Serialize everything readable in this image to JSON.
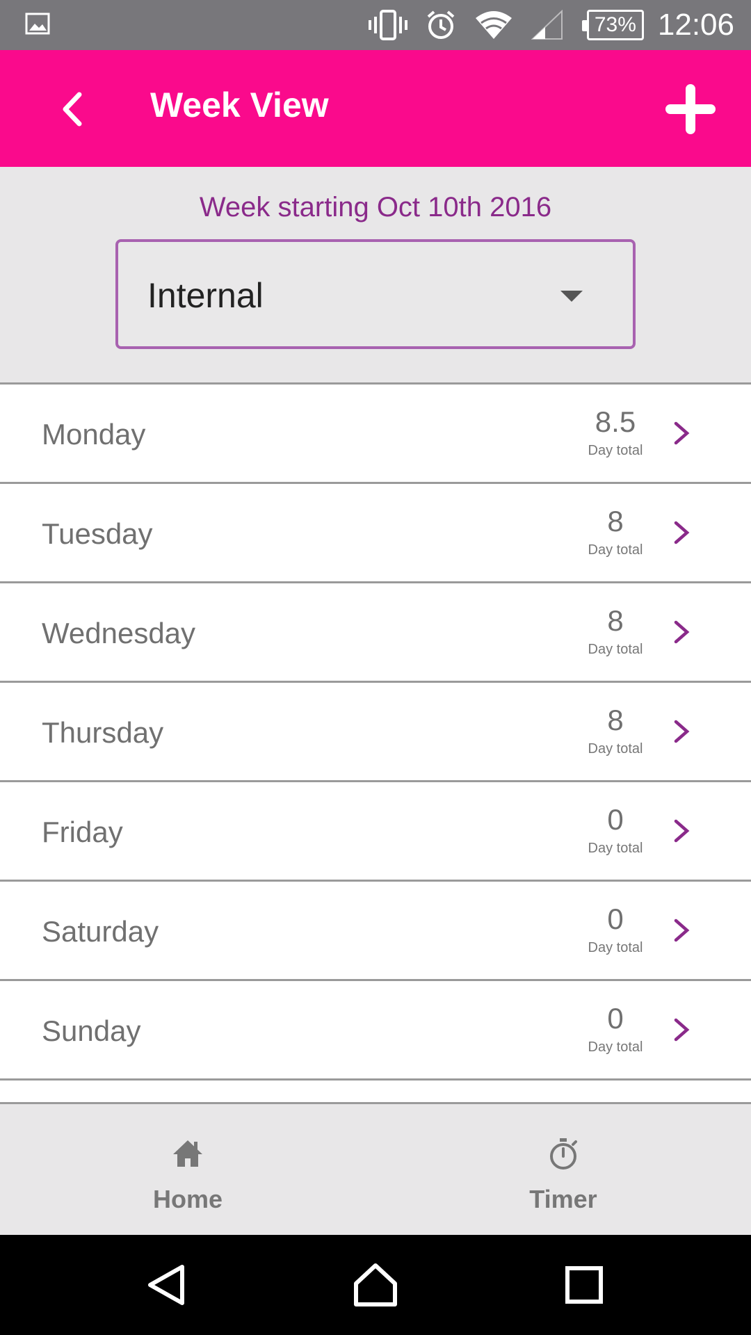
{
  "status_bar": {
    "battery": "73%",
    "time": "12:06",
    "icons": [
      "image-icon",
      "vibrate-icon",
      "alarm-icon",
      "wifi-icon",
      "signal-icon",
      "battery-icon"
    ]
  },
  "app_bar": {
    "title": "Week View",
    "back_icon": "chevron-left-icon",
    "add_icon": "plus-icon",
    "color": "#fa0a8c"
  },
  "week": {
    "label": "Week starting Oct 10th 2016",
    "project_select": {
      "value": "Internal"
    }
  },
  "days": [
    {
      "name": "Monday",
      "total": "8.5",
      "total_label": "Day total"
    },
    {
      "name": "Tuesday",
      "total": "8",
      "total_label": "Day total"
    },
    {
      "name": "Wednesday",
      "total": "8",
      "total_label": "Day total"
    },
    {
      "name": "Thursday",
      "total": "8",
      "total_label": "Day total"
    },
    {
      "name": "Friday",
      "total": "0",
      "total_label": "Day total"
    },
    {
      "name": "Saturday",
      "total": "0",
      "total_label": "Day total"
    },
    {
      "name": "Sunday",
      "total": "0",
      "total_label": "Day total"
    }
  ],
  "bottom_nav": {
    "home": {
      "label": "Home",
      "icon": "home-icon"
    },
    "timer": {
      "label": "Timer",
      "icon": "stopwatch-icon"
    }
  },
  "accent_color": "#8a2a8a"
}
